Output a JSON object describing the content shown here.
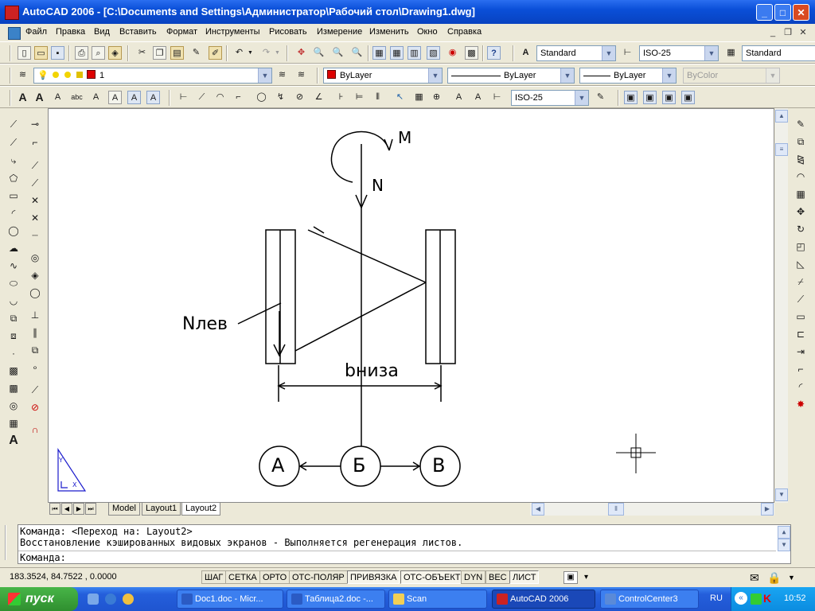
{
  "window": {
    "title": "AutoCAD 2006 - [C:\\Documents and Settings\\Администратор\\Рабочий стол\\Drawing1.dwg]"
  },
  "menu": {
    "items": [
      "Файл",
      "Правка",
      "Вид",
      "Вставить",
      "Формат",
      "Инструменты",
      "Рисовать",
      "Измерение",
      "Изменить",
      "Окно",
      "Справка"
    ]
  },
  "toolbar1": {
    "text_style": "Standard",
    "dim_style": "ISO-25",
    "table_style": "Standard"
  },
  "toolbar2": {
    "layer": "1",
    "color": "ByLayer",
    "linetype": "ByLayer",
    "lineweight": "ByLayer",
    "plotstyle": "ByColor"
  },
  "toolbar3": {
    "dim_style": "ISO-25"
  },
  "drawing": {
    "label_m": "M",
    "label_n": "N",
    "label_nlev": "Nлев",
    "label_bniza": "bниза",
    "node_a": "А",
    "node_b": "Б",
    "node_v": "В",
    "ucs_y": "Y",
    "ucs_x": "X"
  },
  "tabs": {
    "model": "Model",
    "layout1": "Layout1",
    "layout2": "Layout2"
  },
  "command": {
    "line1": "Команда:  <Переход на: Layout2>",
    "line2": "Восстановление кэшированных видовых экранов - Выполняется регенерация листов.",
    "prompt": "Команда:"
  },
  "status": {
    "coords": "183.3524, 84.7522 , 0.0000",
    "toggles": [
      "ШАГ",
      "СЕТКА",
      "ОРТО",
      "ОТС-ПОЛЯР",
      "ПРИВЯЗКА",
      "ОТС-ОБЪЕКТ",
      "DYN",
      "ВЕС",
      "ЛИСТ"
    ]
  },
  "taskbar": {
    "start": "пуск",
    "buttons": [
      "Doc1.doc - Micr...",
      "Таблица2.doc -...",
      "Scan",
      "AutoCAD 2006",
      "ControlCenter3"
    ],
    "lang": "RU",
    "time": "10:52"
  },
  "colors": {
    "title_blue": "#0a4fd8",
    "taskbar_blue": "#245edb",
    "start_green": "#3a9e3a",
    "bylayer_red": "#d00000"
  }
}
